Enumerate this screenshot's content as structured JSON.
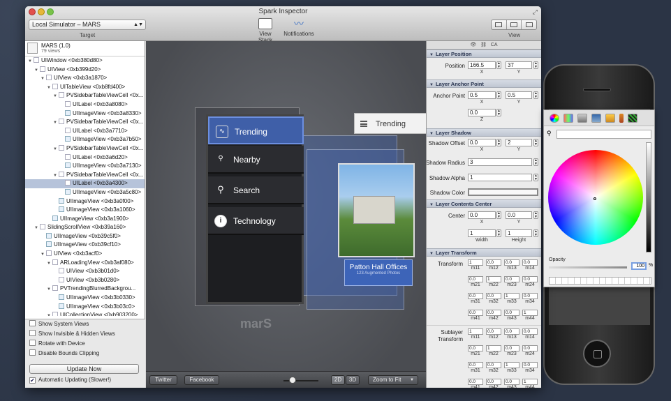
{
  "window": {
    "title": "Spark Inspector",
    "target": {
      "value": "Local Simulator – MARS",
      "caption": "Target"
    },
    "toolbar": [
      {
        "label": "View Stack"
      },
      {
        "label": "Notifications"
      }
    ],
    "view_caption": "View"
  },
  "app": {
    "name": "MARS (1.0)",
    "views": "79 views"
  },
  "tree": [
    {
      "label": "UIWindow <0xb380d80>",
      "indent": 0,
      "kind": "view",
      "open": true
    },
    {
      "label": "UIView <0xb399d20>",
      "indent": 1,
      "kind": "view",
      "open": true
    },
    {
      "label": "UIView <0xb3a1870>",
      "indent": 2,
      "kind": "view",
      "open": true
    },
    {
      "label": "UITableView <0xb8fd400>",
      "indent": 3,
      "kind": "view",
      "open": true
    },
    {
      "label": "PVSidebarTableViewCell <0x...",
      "indent": 4,
      "kind": "view",
      "open": true
    },
    {
      "label": "UILabel <0xb3a8080>",
      "indent": 5,
      "kind": "view"
    },
    {
      "label": "UIImageView <0xb3a8330>",
      "indent": 5,
      "kind": "img"
    },
    {
      "label": "PVSidebarTableViewCell <0x...",
      "indent": 4,
      "kind": "view",
      "open": true
    },
    {
      "label": "UILabel <0xb3a7710>",
      "indent": 5,
      "kind": "view"
    },
    {
      "label": "UIImageView <0xb3a7b50>",
      "indent": 5,
      "kind": "img"
    },
    {
      "label": "PVSidebarTableViewCell <0x...",
      "indent": 4,
      "kind": "view",
      "open": true
    },
    {
      "label": "UILabel <0xb3a6d20>",
      "indent": 5,
      "kind": "view"
    },
    {
      "label": "UIImageView <0xb3a7130>",
      "indent": 5,
      "kind": "img"
    },
    {
      "label": "PVSidebarTableViewCell <0x...",
      "indent": 4,
      "kind": "view",
      "open": true
    },
    {
      "label": "UILabel <0xb3a4300>",
      "indent": 5,
      "kind": "view",
      "selected": true
    },
    {
      "label": "UIImageView <0xb3a5c80>",
      "indent": 5,
      "kind": "img"
    },
    {
      "label": "UIImageView <0xb3a0f00>",
      "indent": 4,
      "kind": "img"
    },
    {
      "label": "UIImageView <0xb3a1060>",
      "indent": 4,
      "kind": "img"
    },
    {
      "label": "UIImageView <0xb3a1900>",
      "indent": 3,
      "kind": "img"
    },
    {
      "label": "SlidingScrollView <0xb39a160>",
      "indent": 1,
      "kind": "view",
      "open": true
    },
    {
      "label": "UIImageView <0xb39c5f0>",
      "indent": 2,
      "kind": "img"
    },
    {
      "label": "UIImageView <0xb39cf10>",
      "indent": 2,
      "kind": "img"
    },
    {
      "label": "UIView <0xb3acf0>",
      "indent": 2,
      "kind": "view",
      "open": true
    },
    {
      "label": "ARLoadingView <0xb3af080>",
      "indent": 3,
      "kind": "view",
      "open": true
    },
    {
      "label": "UIView <0xb3b01d0>",
      "indent": 4,
      "kind": "view"
    },
    {
      "label": "UIView <0xb3b0280>",
      "indent": 4,
      "kind": "view"
    },
    {
      "label": "PVTrendingBlurredBackgrou...",
      "indent": 3,
      "kind": "view",
      "open": true
    },
    {
      "label": "UIImageView <0xb3b0330>",
      "indent": 4,
      "kind": "img"
    },
    {
      "label": "UIImageView <0xb3b03c0>",
      "indent": 4,
      "kind": "img"
    },
    {
      "label": "UICollectionView <0xb903200>",
      "indent": 3,
      "kind": "view",
      "open": true
    }
  ],
  "options": {
    "items": [
      {
        "label": "Show System Views",
        "checked": false
      },
      {
        "label": "Show Invisible & Hidden Views",
        "checked": false
      },
      {
        "label": "Rotate with Device",
        "checked": false
      },
      {
        "label": "Disable Bounds Clipping",
        "checked": false
      }
    ],
    "update_button": "Update Now",
    "auto_update": {
      "label": "Automatic Updating (Slower!)",
      "checked": true
    }
  },
  "canvas": {
    "menu": [
      "Trending",
      "Nearby",
      "Search",
      "Technology"
    ],
    "header_title": "Trending",
    "banner_title": "Patton Hall Offices",
    "banner_sub": "123 Augmented Photos",
    "logo": "marS",
    "bottom": {
      "twitter": "Twitter",
      "facebook": "Facebook",
      "mode2d": "2D",
      "mode3d": "3D",
      "zoom": "Zoom to Fit"
    }
  },
  "inspector": {
    "tab_ca": "CA",
    "layer_position": {
      "title": "Layer Position",
      "label": "Position",
      "x": "166.5",
      "y": "37",
      "xl": "X",
      "yl": "Y"
    },
    "anchor": {
      "title": "Layer Anchor Point",
      "label": "Anchor Point",
      "x": "0.5",
      "y": "0.5",
      "z": "0.0",
      "xl": "X",
      "yl": "Y",
      "zl": "Z"
    },
    "shadow": {
      "title": "Layer Shadow",
      "offset_label": "Shadow Offset",
      "ox": "0.0",
      "oy": "2",
      "xl": "X",
      "yl": "Y",
      "radius_label": "Shadow Radius",
      "radius": "3",
      "alpha_label": "Shadow Alpha",
      "alpha": "1",
      "color_label": "Shadow Color"
    },
    "contents_center": {
      "title": "Layer Contents Center",
      "label": "Center",
      "x": "0.0",
      "y": "0.0",
      "xl": "X",
      "yl": "Y",
      "w": "1",
      "h": "1",
      "wl": "Width",
      "hl": "Height"
    },
    "transform": {
      "title": "Layer Transform",
      "label": "Transform",
      "cells": [
        [
          "1",
          "0.0",
          "0.0",
          "0.0"
        ],
        [
          "0.0",
          "1",
          "0.0",
          "0.0"
        ],
        [
          "0.0",
          "0.0",
          "1",
          "0.0"
        ],
        [
          "0.0",
          "0.0",
          "0.0",
          "1"
        ]
      ],
      "labels": [
        [
          "m11",
          "m12",
          "m13",
          "m14"
        ],
        [
          "m21",
          "m22",
          "m23",
          "m24"
        ],
        [
          "m31",
          "m32",
          "m33",
          "m34"
        ],
        [
          "m41",
          "m42",
          "m43",
          "m44"
        ]
      ],
      "sub_label_1": "Sublayer",
      "sub_label_2": "Transform",
      "sub_cells": [
        [
          "1",
          "0.0",
          "0.0",
          "0.0"
        ],
        [
          "0.0",
          "1",
          "0.0",
          "0.0"
        ],
        [
          "0.0",
          "0.0",
          "1",
          "0.0"
        ],
        [
          "0.0",
          "0.0",
          "0.0",
          "1"
        ]
      ]
    }
  },
  "picker": {
    "opacity_label": "Opacity",
    "opacity_value": "100",
    "pct": "%"
  },
  "colors": {
    "selection": "#b6c3da",
    "accent": "#3f5fa8"
  }
}
